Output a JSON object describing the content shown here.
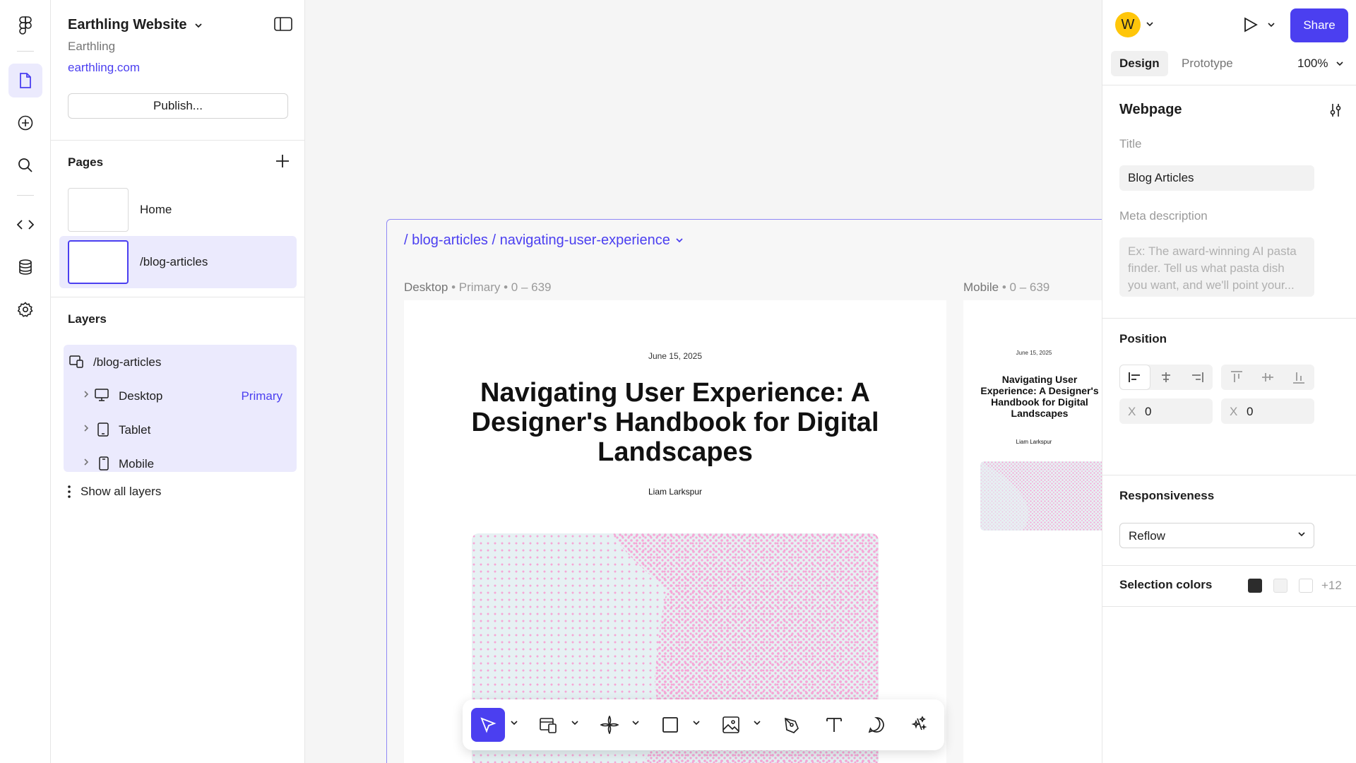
{
  "project": {
    "name": "Earthling Website",
    "team": "Earthling",
    "domain": "earthling.com",
    "publish_label": "Publish..."
  },
  "rail": {
    "icons": [
      "figma-logo-icon",
      "page-icon",
      "add-icon",
      "search-icon",
      "code-icon",
      "database-icon",
      "settings-icon"
    ]
  },
  "pages": {
    "heading": "Pages",
    "items": [
      {
        "label": "Home",
        "selected": false
      },
      {
        "label": "/blog-articles",
        "selected": true
      }
    ]
  },
  "layers": {
    "heading": "Layers",
    "root": "/blog-articles",
    "items": [
      {
        "label": "Desktop",
        "badge": "Primary",
        "icon": "desktop-icon"
      },
      {
        "label": "Tablet",
        "badge": "",
        "icon": "tablet-icon"
      },
      {
        "label": "Mobile",
        "badge": "",
        "icon": "mobile-icon"
      }
    ],
    "show_all_label": "Show all layers"
  },
  "canvas": {
    "breadcrumb": "/ blog-articles / navigating-user-experience",
    "desktop_label": {
      "name": "Desktop",
      "primary": "Primary",
      "range": "0 – 639"
    },
    "mobile_label": {
      "name": "Mobile",
      "range": "0 – 639"
    },
    "article": {
      "date": "June 15, 2025",
      "title": "Navigating User Experience: A Designer's Handbook for Digital Landscapes",
      "author": "Liam Larkspur"
    }
  },
  "toolbar": {
    "tools": [
      "cursor-icon",
      "layout-icon",
      "component-icon",
      "rectangle-icon",
      "image-icon",
      "pen-icon",
      "text-icon",
      "comment-icon",
      "ai-sparkle-icon"
    ],
    "active": "cursor-icon"
  },
  "right_panel": {
    "avatar_initial": "W",
    "share_label": "Share",
    "tabs": [
      {
        "label": "Design",
        "active": true
      },
      {
        "label": "Prototype",
        "active": false
      }
    ],
    "zoom": "100%",
    "webpage": {
      "heading": "Webpage",
      "title_label": "Title",
      "title_value": "Blog Articles",
      "meta_label": "Meta description",
      "meta_placeholder": "Ex: The award-winning AI pasta finder. Tell us what pasta dish you want, and we'll point your..."
    },
    "position": {
      "heading": "Position",
      "x1_label": "X",
      "x1_value": "0",
      "x2_label": "X",
      "x2_value": "0"
    },
    "responsiveness": {
      "heading": "Responsiveness",
      "value": "Reflow"
    },
    "selection_colors": {
      "heading": "Selection colors",
      "colors": [
        "#2c2c2c",
        "#f2f2f2",
        "#ffffff"
      ],
      "more": "+12"
    }
  },
  "colors": {
    "accent": "#4b3ff0",
    "accent_light": "#ebeafd",
    "avatar": "#ffc60a",
    "image_pink": "#f6a6d6",
    "image_bg": "#e6f1f3"
  }
}
